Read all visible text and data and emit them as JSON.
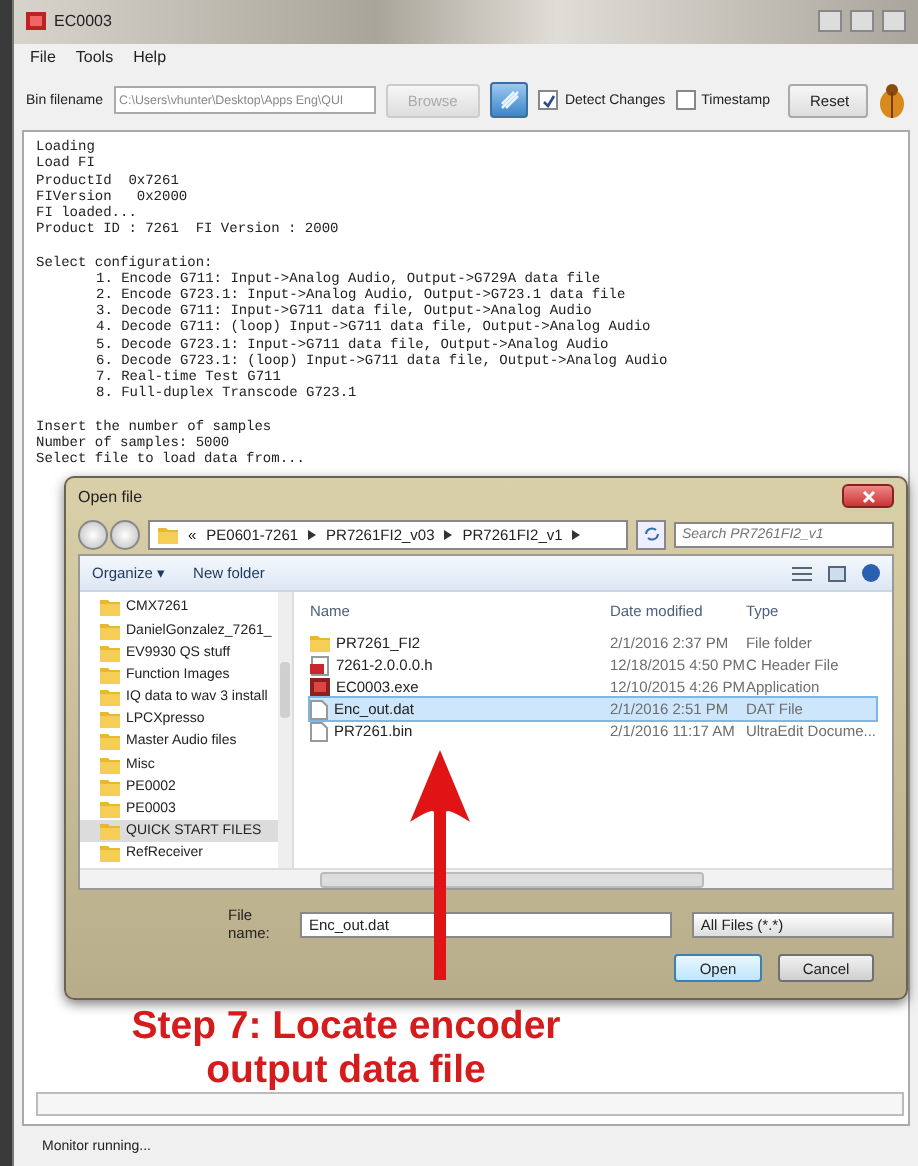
{
  "window": {
    "title": "EC0003"
  },
  "menu": [
    "File",
    "Tools",
    "Help"
  ],
  "toolbar": {
    "bin_label": "Bin filename",
    "bin_value": "C:\\Users\\vhunter\\Desktop\\Apps Eng\\QUI",
    "browse": {
      "label": "Browse",
      "disabled": true
    },
    "detect_changes": {
      "label": "Detect Changes",
      "checked": true
    },
    "timestamp": {
      "label": "Timestamp",
      "checked": false
    },
    "reset": "Reset"
  },
  "console": {
    "lines_before": [
      "Loading",
      "Load FI",
      "ProductId  0x7261",
      "FIVersion   0x2000",
      "FI loaded...",
      "Product ID : 7261  FI Version : 2000"
    ],
    "config_heading": "Select configuration:",
    "options": [
      "1. Encode G711: Input->Analog Audio, Output->G729A data file",
      "2. Encode G723.1: Input->Analog Audio, Output->G723.1 data file",
      "3. Decode G711: Input->G711 data file, Output->Analog Audio",
      "4. Decode G711: (loop) Input->G711 data file, Output->Analog Audio",
      "5. Decode G723.1: Input->G711 data file, Output->Analog Audio",
      "6. Decode G723.1: (loop) Input->G711 data file, Output->Analog Audio",
      "7. Real-time Test G711",
      "8. Full-duplex Transcode G723.1"
    ],
    "lines_after": [
      "Insert the number of samples",
      "Number of samples: 5000",
      "Select file to load data from..."
    ]
  },
  "dialog": {
    "title": "Open file",
    "path": [
      "«",
      "PE0601-7261",
      "PR7261FI2_v03",
      "PR7261FI2_v1"
    ],
    "search_placeholder": "Search PR7261FI2_v1",
    "organize": "Organize ▾",
    "new_folder": "New folder",
    "nav": [
      {
        "label": "CMX7261",
        "selected": false
      },
      {
        "label": "DanielGonzalez_7261_",
        "selected": false
      },
      {
        "label": "EV9930 QS stuff",
        "selected": false
      },
      {
        "label": "Function Images",
        "selected": false
      },
      {
        "label": "IQ data to wav 3 install",
        "selected": false
      },
      {
        "label": "LPCXpresso",
        "selected": false
      },
      {
        "label": "Master Audio files",
        "selected": false
      },
      {
        "label": "Misc",
        "selected": false
      },
      {
        "label": "PE0002",
        "selected": false
      },
      {
        "label": "PE0003",
        "selected": false
      },
      {
        "label": "QUICK START FILES",
        "selected": true
      },
      {
        "label": "RefReceiver",
        "selected": false
      }
    ],
    "columns": [
      "Name",
      "Date modified",
      "Type"
    ],
    "files": [
      {
        "kind": "folder",
        "name": "PR7261_FI2",
        "date": "2/1/2016 2:37 PM",
        "type": "File folder",
        "selected": false
      },
      {
        "kind": "header",
        "name": "7261-2.0.0.0.h",
        "date": "12/18/2015 4:50 PM",
        "type": "C Header File",
        "selected": false
      },
      {
        "kind": "exe",
        "name": "EC0003.exe",
        "date": "12/10/2015 4:26 PM",
        "type": "Application",
        "selected": false
      },
      {
        "kind": "doc",
        "name": "Enc_out.dat",
        "date": "2/1/2016 2:51 PM",
        "type": "DAT File",
        "selected": true
      },
      {
        "kind": "doc",
        "name": "PR7261.bin",
        "date": "2/1/2016 11:17 AM",
        "type": "UltraEdit Docume...",
        "selected": false
      }
    ],
    "filename_label": "File name:",
    "filename_value": "Enc_out.dat",
    "filter": "All Files (*.*)",
    "open": "Open",
    "cancel": "Cancel"
  },
  "annotation": "Step 7: Locate encoder output data file",
  "status_bar": "Monitor running..."
}
